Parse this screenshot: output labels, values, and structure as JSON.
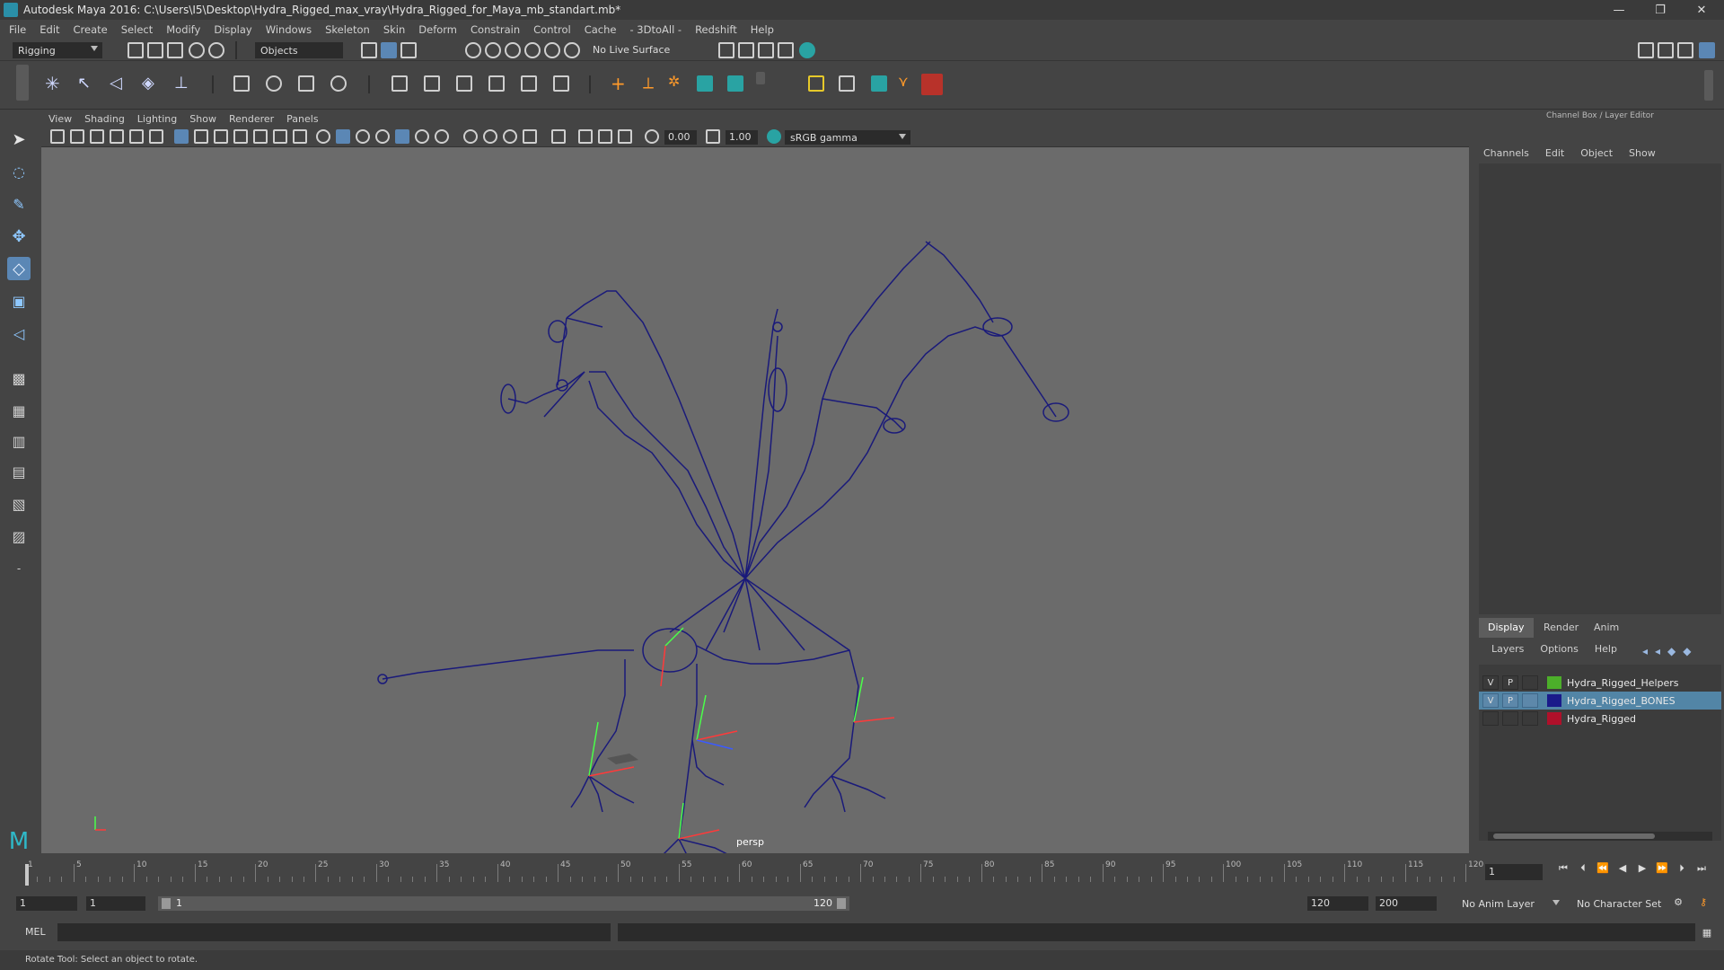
{
  "window": {
    "title": "Autodesk Maya 2016: C:\\Users\\I5\\Desktop\\Hydra_Rigged_max_vray\\Hydra_Rigged_for_Maya_mb_standart.mb*",
    "min": "—",
    "max": "❐",
    "close": "✕"
  },
  "menu": [
    "File",
    "Edit",
    "Create",
    "Select",
    "Modify",
    "Display",
    "Windows",
    "Skeleton",
    "Skin",
    "Deform",
    "Constrain",
    "Control",
    "Cache",
    "- 3DtoAll -",
    "Redshift",
    "Help"
  ],
  "statusline": {
    "menuset": "Rigging",
    "select_mode": "Objects",
    "live_surface": "No Live Surface"
  },
  "viewport": {
    "menu": [
      "View",
      "Shading",
      "Lighting",
      "Show",
      "Renderer",
      "Panels"
    ],
    "exposure": "0.00",
    "gamma": "1.00",
    "colorspace": "sRGB gamma",
    "camera": "persp",
    "bone_color": "#1a1a7a",
    "bg_color": "#6b6b6b"
  },
  "channelbox": {
    "title": "Channel Box / Layer Editor",
    "tabs": [
      "Channels",
      "Edit",
      "Object",
      "Show"
    ]
  },
  "layer_editor": {
    "tabs": [
      "Display",
      "Render",
      "Anim"
    ],
    "menu": [
      "Layers",
      "Options",
      "Help"
    ],
    "layers": [
      {
        "v": "V",
        "p": "P",
        "name": "Hydra_Rigged_Helpers",
        "color": "#4caf2a",
        "selected": false
      },
      {
        "v": "V",
        "p": "P",
        "name": "Hydra_Rigged_BONES",
        "color": "#1a1a8a",
        "selected": true
      },
      {
        "v": "",
        "p": "",
        "name": "Hydra_Rigged",
        "color": "#b0102a",
        "selected": false
      }
    ]
  },
  "timeline": {
    "ticks": [
      "1",
      "5",
      "10",
      "15",
      "20",
      "25",
      "30",
      "35",
      "40",
      "45",
      "50",
      "55",
      "60",
      "65",
      "70",
      "75",
      "80",
      "85",
      "90",
      "95",
      "100",
      "105",
      "110",
      "115",
      "120"
    ],
    "current_frame": "1"
  },
  "range": {
    "start": "1",
    "playback_start": "1",
    "slider_start": "1",
    "slider_end": "120",
    "playback_end": "120",
    "end": "200",
    "anim_layer": "No Anim Layer",
    "char_set": "No Character Set"
  },
  "cmd": {
    "label": "MEL"
  },
  "help": {
    "text": "Rotate Tool: Select an object to rotate."
  }
}
